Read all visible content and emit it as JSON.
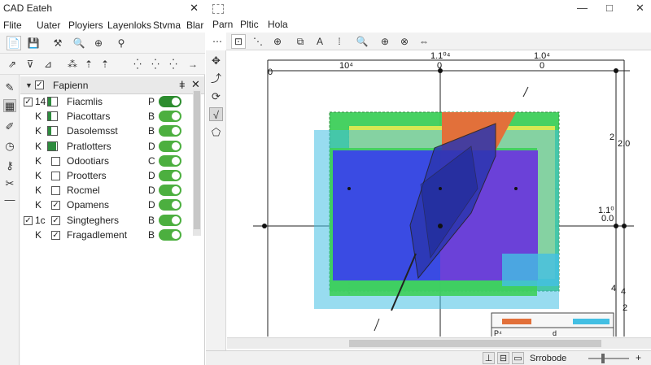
{
  "left_window": {
    "title": "CAD Eateh",
    "close": "✕",
    "menu": [
      "Flite",
      "Uater",
      "Ployiers",
      "Layenloks",
      "Stvma",
      "Blar"
    ],
    "toolbar1": [
      "📄",
      "💾",
      "⚒",
      "🔍",
      "⊕",
      "⚲"
    ],
    "toolbar2": [
      "⇗",
      "⊽",
      "⊿",
      "⁂",
      "⇡",
      "⇡",
      "⁛",
      "⁛",
      "⁛",
      "→"
    ],
    "side_icons": [
      "pen-icon",
      "grid-icon",
      "ruler-icon",
      "clock-icon",
      "key-icon",
      "scissors-icon",
      "line-icon"
    ],
    "layers_panel": {
      "title": "Fapienn",
      "pin": "ǂ",
      "close": "✕",
      "rows": [
        {
          "key": "14",
          "name": "Fiacmlis",
          "code": "P",
          "checked": false,
          "swatch": "outline",
          "on": true
        },
        {
          "key": "K",
          "name": "Piacottars",
          "code": "B",
          "checked": false,
          "swatch": "outline",
          "on": false
        },
        {
          "key": "K",
          "name": "Dasolemsst",
          "code": "B",
          "checked": false,
          "swatch": "outline",
          "on": false
        },
        {
          "key": "K",
          "name": "Pratlotters",
          "code": "D",
          "checked": false,
          "swatch": "green",
          "on": false
        },
        {
          "key": "K",
          "name": "Odootiars",
          "code": "C",
          "checked": false,
          "swatch": "none",
          "on": false
        },
        {
          "key": "K",
          "name": "Prootters",
          "code": "D",
          "checked": false,
          "swatch": "none",
          "on": false
        },
        {
          "key": "K",
          "name": "Rocmel",
          "code": "D",
          "checked": false,
          "swatch": "none",
          "on": false
        },
        {
          "key": "K",
          "name": "Opamens",
          "code": "D",
          "checked": true,
          "swatch": "none",
          "on": false
        },
        {
          "key": "1c",
          "name": "Singteghers",
          "code": "B",
          "checked": true,
          "swatch": "none",
          "on": false
        },
        {
          "key": "K",
          "name": "Fragadlement",
          "code": "B",
          "checked": true,
          "swatch": "none",
          "on": false
        }
      ]
    }
  },
  "right_window": {
    "menu": [
      "Parn",
      "Pltic",
      "Hola"
    ],
    "window_buttons": [
      "—",
      "□",
      "✕"
    ],
    "toolbar": [
      "⋯",
      "⊡",
      "⋱",
      "⊕",
      "⧉",
      "A",
      "⁞",
      "🔍",
      "⊕",
      "⊗",
      "⇔"
    ],
    "tools": [
      "move-icon",
      "vertex-icon",
      "rotate-icon",
      "sqrt-icon",
      "shield-icon"
    ],
    "dims": {
      "top1": "10⁴",
      "top2": "1.1⁰⁴",
      "top3": "1.0⁴",
      "top_sub1": "0",
      "top_sub2": "0",
      "left": "0",
      "right_top": "2",
      "right_top_small": "2.0",
      "right_mid_a": "1.1⁰",
      "right_mid_b": "0.0",
      "right_low": "4",
      "right_low_small": "4",
      "right_low_b": "2"
    },
    "legend_small": [
      "P⁴",
      "d"
    ],
    "status_text": "Srrobode",
    "zoom": "+",
    "colors": {
      "green": "#3ecf5a",
      "yellow": "#e6ea52",
      "purple": "#5b3ed6",
      "blue": "#3a4be3",
      "orange": "#e2703a",
      "cyan": "#43bfe3"
    }
  }
}
